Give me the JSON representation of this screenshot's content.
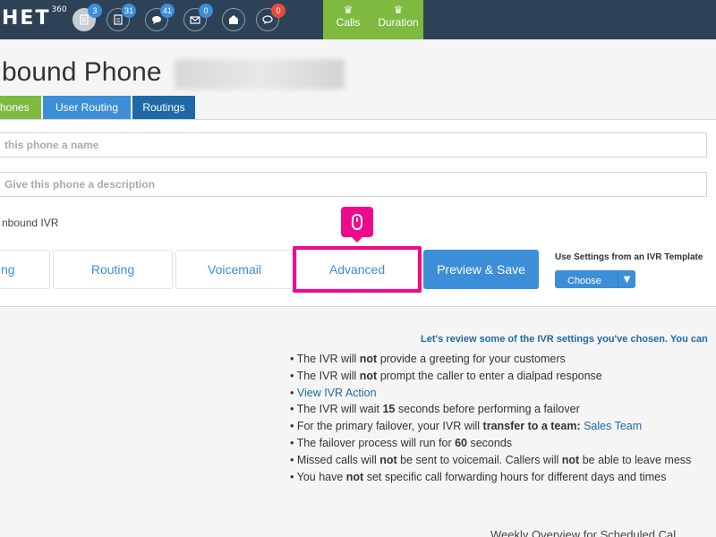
{
  "topbar": {
    "logo": "HET",
    "logo_sup": "360",
    "icons": [
      {
        "name": "document-icon",
        "badge": "3"
      },
      {
        "name": "form-icon",
        "badge": "31"
      },
      {
        "name": "chat-icon",
        "badge": "41"
      },
      {
        "name": "mail-icon",
        "badge": "0"
      },
      {
        "name": "envelope-open-icon",
        "badge": ""
      },
      {
        "name": "speech-bubble-icon",
        "badge": "0"
      }
    ],
    "right_items": [
      {
        "label": "Calls",
        "icon": "crown-icon"
      },
      {
        "label": "Duration",
        "icon": "crown-icon"
      }
    ]
  },
  "page": {
    "title": "bound Phone"
  },
  "tabs": [
    {
      "label": "hones"
    },
    {
      "label": "User Routing"
    },
    {
      "label": "Routings"
    }
  ],
  "form": {
    "name_placeholder": "this phone a name",
    "desc_placeholder": "Give this phone a description",
    "ivr_label": "nbound IVR"
  },
  "steps": [
    {
      "label": "ng"
    },
    {
      "label": "Routing"
    },
    {
      "label": "Voicemail"
    },
    {
      "label": "Advanced"
    }
  ],
  "preview_label": "Preview & Save",
  "template": {
    "label": "Use Settings from an IVR Template",
    "select_value": "Choose"
  },
  "review": {
    "title": "Let's review some of the IVR settings you've chosen. You can",
    "items": [
      {
        "pre": "• The IVR will ",
        "bold": "not",
        "post": " provide a greeting for your customers",
        "link": ""
      },
      {
        "pre": "• The IVR will ",
        "bold": "not",
        "post": " prompt the caller to enter a dialpad response",
        "link": ""
      },
      {
        "pre": "• ",
        "bold": "",
        "post": "",
        "link": "View IVR Action"
      },
      {
        "pre": "• The IVR will wait ",
        "bold": "15",
        "post": " seconds before performing a failover",
        "link": ""
      },
      {
        "pre": "• For the primary failover, your IVR will ",
        "bold": "transfer to a team:",
        "post": " ",
        "link": "Sales Team"
      },
      {
        "pre": "• The failover process will run for ",
        "bold": "60",
        "post": " seconds",
        "link": ""
      },
      {
        "pre": "• Missed calls will ",
        "bold": "not",
        "post": " be sent to voicemail. Callers will ",
        "bold2": "not",
        "post2": " be able to leave mess",
        "link": ""
      },
      {
        "pre": "• You have ",
        "bold": "not",
        "post": " set specific call forwarding hours for different days and times",
        "link": ""
      }
    ]
  },
  "weekly_text": "Weekly Overview for Scheduled Cal"
}
